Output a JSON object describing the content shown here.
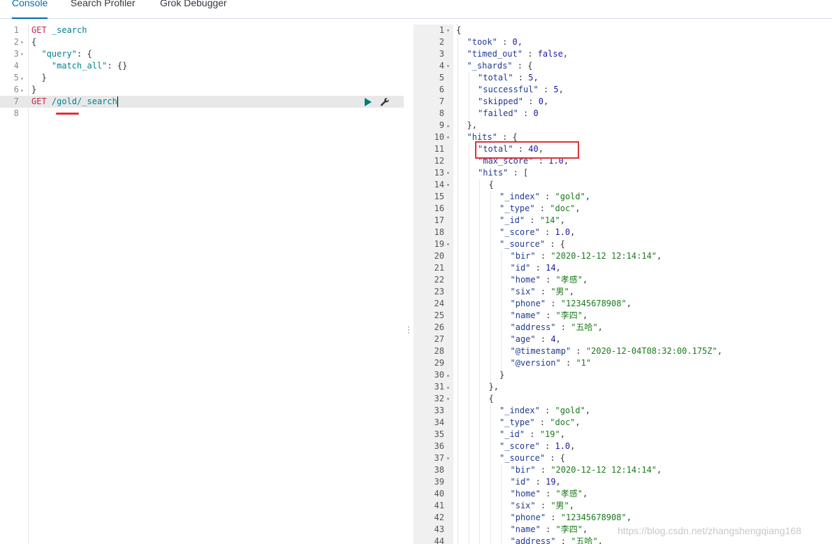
{
  "tabs": [
    {
      "label": "Console",
      "active": true
    },
    {
      "label": "Search Profiler",
      "active": false
    },
    {
      "label": "Grok Debugger",
      "active": false
    }
  ],
  "editor": {
    "lines": [
      {
        "num": "1",
        "fold": "",
        "parts": [
          [
            "m",
            "GET"
          ],
          [
            "p",
            " "
          ],
          [
            "u",
            "_search"
          ]
        ]
      },
      {
        "num": "2",
        "fold": "▾",
        "parts": [
          [
            "p",
            "{"
          ]
        ]
      },
      {
        "num": "3",
        "fold": "▾",
        "parts": [
          [
            "p",
            "  "
          ],
          [
            "k",
            "\"query\""
          ],
          [
            "p",
            ": {"
          ]
        ]
      },
      {
        "num": "4",
        "fold": "",
        "parts": [
          [
            "p",
            "    "
          ],
          [
            "k",
            "\"match_all\""
          ],
          [
            "p",
            ": {}"
          ]
        ]
      },
      {
        "num": "5",
        "fold": "▴",
        "parts": [
          [
            "p",
            "  }"
          ]
        ]
      },
      {
        "num": "6",
        "fold": "▴",
        "parts": [
          [
            "p",
            "}"
          ]
        ]
      },
      {
        "num": "7",
        "fold": "",
        "parts": [
          [
            "m",
            "GET"
          ],
          [
            "p",
            " "
          ],
          [
            "u",
            "/gold/_search"
          ]
        ]
      },
      {
        "num": "8",
        "fold": "",
        "parts": []
      }
    ],
    "active_line": 7,
    "run_icon": "play-icon",
    "settings_icon": "wrench-icon"
  },
  "output": {
    "lines": [
      {
        "num": "1",
        "fold": "▾",
        "indent": 0,
        "parts": [
          [
            "p",
            "{"
          ]
        ]
      },
      {
        "num": "2",
        "fold": "",
        "indent": 1,
        "parts": [
          [
            "key",
            "\"took\""
          ],
          [
            "p",
            " : "
          ],
          [
            "n",
            "0"
          ],
          [
            "p",
            ","
          ]
        ]
      },
      {
        "num": "3",
        "fold": "",
        "indent": 1,
        "parts": [
          [
            "key",
            "\"timed_out\""
          ],
          [
            "p",
            " : "
          ],
          [
            "b",
            "false"
          ],
          [
            "p",
            ","
          ]
        ]
      },
      {
        "num": "4",
        "fold": "▾",
        "indent": 1,
        "parts": [
          [
            "key",
            "\"_shards\""
          ],
          [
            "p",
            " : {"
          ]
        ]
      },
      {
        "num": "5",
        "fold": "",
        "indent": 2,
        "parts": [
          [
            "key",
            "\"total\""
          ],
          [
            "p",
            " : "
          ],
          [
            "n",
            "5"
          ],
          [
            "p",
            ","
          ]
        ]
      },
      {
        "num": "6",
        "fold": "",
        "indent": 2,
        "parts": [
          [
            "key",
            "\"successful\""
          ],
          [
            "p",
            " : "
          ],
          [
            "n",
            "5"
          ],
          [
            "p",
            ","
          ]
        ]
      },
      {
        "num": "7",
        "fold": "",
        "indent": 2,
        "parts": [
          [
            "key",
            "\"skipped\""
          ],
          [
            "p",
            " : "
          ],
          [
            "n",
            "0"
          ],
          [
            "p",
            ","
          ]
        ]
      },
      {
        "num": "8",
        "fold": "",
        "indent": 2,
        "parts": [
          [
            "key",
            "\"failed\""
          ],
          [
            "p",
            " : "
          ],
          [
            "n",
            "0"
          ]
        ]
      },
      {
        "num": "9",
        "fold": "▴",
        "indent": 1,
        "parts": [
          [
            "p",
            "},"
          ]
        ]
      },
      {
        "num": "10",
        "fold": "▾",
        "indent": 1,
        "parts": [
          [
            "key",
            "\"hits\""
          ],
          [
            "p",
            " : {"
          ]
        ]
      },
      {
        "num": "11",
        "fold": "",
        "indent": 2,
        "parts": [
          [
            "key",
            "\"total\""
          ],
          [
            "p",
            " : "
          ],
          [
            "n",
            "40"
          ],
          [
            "p",
            ","
          ]
        ]
      },
      {
        "num": "12",
        "fold": "",
        "indent": 2,
        "parts": [
          [
            "key",
            "\"max_score\""
          ],
          [
            "p",
            " : "
          ],
          [
            "n",
            "1.0"
          ],
          [
            "p",
            ","
          ]
        ]
      },
      {
        "num": "13",
        "fold": "▾",
        "indent": 2,
        "parts": [
          [
            "key",
            "\"hits\""
          ],
          [
            "p",
            " : ["
          ]
        ]
      },
      {
        "num": "14",
        "fold": "▾",
        "indent": 3,
        "parts": [
          [
            "p",
            "{"
          ]
        ]
      },
      {
        "num": "15",
        "fold": "",
        "indent": 4,
        "parts": [
          [
            "key",
            "\"_index\""
          ],
          [
            "p",
            " : "
          ],
          [
            "s",
            "\"gold\""
          ],
          [
            "p",
            ","
          ]
        ]
      },
      {
        "num": "16",
        "fold": "",
        "indent": 4,
        "parts": [
          [
            "key",
            "\"_type\""
          ],
          [
            "p",
            " : "
          ],
          [
            "s",
            "\"doc\""
          ],
          [
            "p",
            ","
          ]
        ]
      },
      {
        "num": "17",
        "fold": "",
        "indent": 4,
        "parts": [
          [
            "key",
            "\"_id\""
          ],
          [
            "p",
            " : "
          ],
          [
            "s",
            "\"14\""
          ],
          [
            "p",
            ","
          ]
        ]
      },
      {
        "num": "18",
        "fold": "",
        "indent": 4,
        "parts": [
          [
            "key",
            "\"_score\""
          ],
          [
            "p",
            " : "
          ],
          [
            "n",
            "1.0"
          ],
          [
            "p",
            ","
          ]
        ]
      },
      {
        "num": "19",
        "fold": "▾",
        "indent": 4,
        "parts": [
          [
            "key",
            "\"_source\""
          ],
          [
            "p",
            " : {"
          ]
        ]
      },
      {
        "num": "20",
        "fold": "",
        "indent": 5,
        "parts": [
          [
            "key",
            "\"bir\""
          ],
          [
            "p",
            " : "
          ],
          [
            "s",
            "\"2020-12-12 12:14:14\""
          ],
          [
            "p",
            ","
          ]
        ]
      },
      {
        "num": "21",
        "fold": "",
        "indent": 5,
        "parts": [
          [
            "key",
            "\"id\""
          ],
          [
            "p",
            " : "
          ],
          [
            "n",
            "14"
          ],
          [
            "p",
            ","
          ]
        ]
      },
      {
        "num": "22",
        "fold": "",
        "indent": 5,
        "parts": [
          [
            "key",
            "\"home\""
          ],
          [
            "p",
            " : "
          ],
          [
            "s",
            "\"孝感\""
          ],
          [
            "p",
            ","
          ]
        ]
      },
      {
        "num": "23",
        "fold": "",
        "indent": 5,
        "parts": [
          [
            "key",
            "\"six\""
          ],
          [
            "p",
            " : "
          ],
          [
            "s",
            "\"男\""
          ],
          [
            "p",
            ","
          ]
        ]
      },
      {
        "num": "24",
        "fold": "",
        "indent": 5,
        "parts": [
          [
            "key",
            "\"phone\""
          ],
          [
            "p",
            " : "
          ],
          [
            "s",
            "\"12345678908\""
          ],
          [
            "p",
            ","
          ]
        ]
      },
      {
        "num": "25",
        "fold": "",
        "indent": 5,
        "parts": [
          [
            "key",
            "\"name\""
          ],
          [
            "p",
            " : "
          ],
          [
            "s",
            "\"李四\""
          ],
          [
            "p",
            ","
          ]
        ]
      },
      {
        "num": "26",
        "fold": "",
        "indent": 5,
        "parts": [
          [
            "key",
            "\"address\""
          ],
          [
            "p",
            " : "
          ],
          [
            "s",
            "\"五哈\""
          ],
          [
            "p",
            ","
          ]
        ]
      },
      {
        "num": "27",
        "fold": "",
        "indent": 5,
        "parts": [
          [
            "key",
            "\"age\""
          ],
          [
            "p",
            " : "
          ],
          [
            "n",
            "4"
          ],
          [
            "p",
            ","
          ]
        ]
      },
      {
        "num": "28",
        "fold": "",
        "indent": 5,
        "parts": [
          [
            "key",
            "\"@timestamp\""
          ],
          [
            "p",
            " : "
          ],
          [
            "s",
            "\"2020-12-04T08:32:00.175Z\""
          ],
          [
            "p",
            ","
          ]
        ]
      },
      {
        "num": "29",
        "fold": "",
        "indent": 5,
        "parts": [
          [
            "key",
            "\"@version\""
          ],
          [
            "p",
            " : "
          ],
          [
            "s",
            "\"1\""
          ]
        ]
      },
      {
        "num": "30",
        "fold": "▴",
        "indent": 4,
        "parts": [
          [
            "p",
            "}"
          ]
        ]
      },
      {
        "num": "31",
        "fold": "▴",
        "indent": 3,
        "parts": [
          [
            "p",
            "},"
          ]
        ]
      },
      {
        "num": "32",
        "fold": "▾",
        "indent": 3,
        "parts": [
          [
            "p",
            "{"
          ]
        ]
      },
      {
        "num": "33",
        "fold": "",
        "indent": 4,
        "parts": [
          [
            "key",
            "\"_index\""
          ],
          [
            "p",
            " : "
          ],
          [
            "s",
            "\"gold\""
          ],
          [
            "p",
            ","
          ]
        ]
      },
      {
        "num": "34",
        "fold": "",
        "indent": 4,
        "parts": [
          [
            "key",
            "\"_type\""
          ],
          [
            "p",
            " : "
          ],
          [
            "s",
            "\"doc\""
          ],
          [
            "p",
            ","
          ]
        ]
      },
      {
        "num": "35",
        "fold": "",
        "indent": 4,
        "parts": [
          [
            "key",
            "\"_id\""
          ],
          [
            "p",
            " : "
          ],
          [
            "s",
            "\"19\""
          ],
          [
            "p",
            ","
          ]
        ]
      },
      {
        "num": "36",
        "fold": "",
        "indent": 4,
        "parts": [
          [
            "key",
            "\"_score\""
          ],
          [
            "p",
            " : "
          ],
          [
            "n",
            "1.0"
          ],
          [
            "p",
            ","
          ]
        ]
      },
      {
        "num": "37",
        "fold": "▾",
        "indent": 4,
        "parts": [
          [
            "key",
            "\"_source\""
          ],
          [
            "p",
            " : {"
          ]
        ]
      },
      {
        "num": "38",
        "fold": "",
        "indent": 5,
        "parts": [
          [
            "key",
            "\"bir\""
          ],
          [
            "p",
            " : "
          ],
          [
            "s",
            "\"2020-12-12 12:14:14\""
          ],
          [
            "p",
            ","
          ]
        ]
      },
      {
        "num": "39",
        "fold": "",
        "indent": 5,
        "parts": [
          [
            "key",
            "\"id\""
          ],
          [
            "p",
            " : "
          ],
          [
            "n",
            "19"
          ],
          [
            "p",
            ","
          ]
        ]
      },
      {
        "num": "40",
        "fold": "",
        "indent": 5,
        "parts": [
          [
            "key",
            "\"home\""
          ],
          [
            "p",
            " : "
          ],
          [
            "s",
            "\"孝感\""
          ],
          [
            "p",
            ","
          ]
        ]
      },
      {
        "num": "41",
        "fold": "",
        "indent": 5,
        "parts": [
          [
            "key",
            "\"six\""
          ],
          [
            "p",
            " : "
          ],
          [
            "s",
            "\"男\""
          ],
          [
            "p",
            ","
          ]
        ]
      },
      {
        "num": "42",
        "fold": "",
        "indent": 5,
        "parts": [
          [
            "key",
            "\"phone\""
          ],
          [
            "p",
            " : "
          ],
          [
            "s",
            "\"12345678908\""
          ],
          [
            "p",
            ","
          ]
        ]
      },
      {
        "num": "43",
        "fold": "",
        "indent": 5,
        "parts": [
          [
            "key",
            "\"name\""
          ],
          [
            "p",
            " : "
          ],
          [
            "s",
            "\"李四\""
          ],
          [
            "p",
            ","
          ]
        ]
      },
      {
        "num": "44",
        "fold": "",
        "indent": 5,
        "parts": [
          [
            "key",
            "\"address\""
          ],
          [
            "p",
            " : "
          ],
          [
            "s",
            "\"五哈\""
          ],
          [
            "p",
            ","
          ]
        ]
      }
    ]
  },
  "watermark": "https://blog.csdn.net/zhangshengqiang168"
}
